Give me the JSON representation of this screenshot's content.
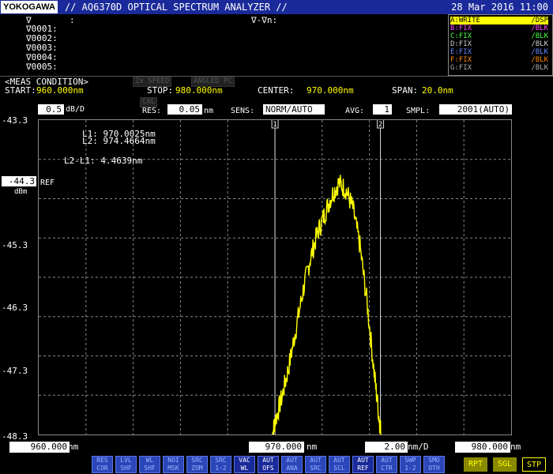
{
  "header": {
    "logo": "YOKOGAWA",
    "title": "// AQ6370D OPTICAL SPECTRUM ANALYZER //",
    "datetime": "28 Mar 2016 11:00"
  },
  "markers": {
    "main_symbol": "∇",
    "main_colon": ":",
    "delta_header": "∇-∇n:",
    "rows": [
      "∇0001:",
      "∇0002:",
      "∇0003:",
      "∇0004:",
      "∇0005:"
    ]
  },
  "traces": [
    {
      "left": "A:WRITE",
      "right": "/DSP",
      "color": "#ffff00",
      "selected": true
    },
    {
      "left": "B:FIX",
      "right": "/BLK",
      "color": "#ff44ff",
      "selected": false
    },
    {
      "left": "C:FIX",
      "right": "/BLK",
      "color": "#44ff44",
      "selected": false
    },
    {
      "left": "D:FIX",
      "right": "/BLK",
      "color": "#cccccc",
      "selected": false
    },
    {
      "left": "E:FIX",
      "right": "/BLK",
      "color": "#6688ff",
      "selected": false
    },
    {
      "left": "F:FIX",
      "right": "/BLK",
      "color": "#ff8800",
      "selected": false
    },
    {
      "left": "G:FIX",
      "right": "/BLK",
      "color": "#aaaaaa",
      "selected": false
    }
  ],
  "meas": {
    "title": "<MEAS CONDITION>",
    "speed_badge": "2x SPEED",
    "angled_badge": "ANGLED PC",
    "start_label": "START:",
    "start_value": "960.000nm",
    "stop_label": "STOP:",
    "stop_value": "980.000nm",
    "center_label": "CENTER:",
    "center_value": "970.000nm",
    "span_label": "SPAN:",
    "span_value": "20.0nm"
  },
  "settings": {
    "scale_value": "0.5",
    "scale_unit": "dB/D",
    "cal_badge": "CAL",
    "res_label": "RES:",
    "res_value": "0.05",
    "res_unit": "nm",
    "sens_label": "SENS:",
    "sens_value": "NORM/AUTO",
    "avg_label": "AVG:",
    "avg_value": "1",
    "smpl_label": "SMPL:",
    "smpl_value": "2001(AUTO)"
  },
  "plot": {
    "ref_value": "-44.3",
    "ref_label": "REF",
    "ref_unit": "dBm",
    "marker_l1": "L1:  970.0025nm",
    "marker_l2": "L2:  974.4664nm",
    "marker_delta": "L2-L1:    4.4639nm",
    "line1_tag": "1",
    "line2_tag": "2",
    "yticks": [
      "-43.3",
      "-45.3",
      "-46.3",
      "-47.3",
      "-48.3"
    ]
  },
  "footer": {
    "start": "960.000",
    "start_unit": "nm",
    "center": "970.000",
    "center_unit": "nm",
    "perdiv": "2.00",
    "perdiv_unit": "nm/D",
    "stop": "980.000",
    "stop_unit": "nm"
  },
  "softkeys": [
    {
      "top": "RES",
      "bottom": "COR",
      "on": false
    },
    {
      "top": "LVL",
      "bottom": "SHF",
      "on": false
    },
    {
      "top": "WL",
      "bottom": "SHF",
      "on": false
    },
    {
      "top": "NOI",
      "bottom": "MSK",
      "on": false
    },
    {
      "top": "SRC",
      "bottom": "ZOM",
      "on": false
    },
    {
      "top": "SRC",
      "bottom": "1-2",
      "on": false
    },
    {
      "top": "VAC",
      "bottom": "WL",
      "on": true
    },
    {
      "top": "AUT",
      "bottom": "OFS",
      "on": true
    },
    {
      "top": "AUT",
      "bottom": "ANA",
      "on": false
    },
    {
      "top": "AUT",
      "bottom": "SRC",
      "on": false
    },
    {
      "top": "AUT",
      "bottom": "SCL",
      "on": false
    },
    {
      "top": "AUT",
      "bottom": "REF",
      "on": true
    },
    {
      "top": "AUT",
      "bottom": "CTR",
      "on": false
    },
    {
      "top": "SWP",
      "bottom": "1-2",
      "on": false
    },
    {
      "top": "SMO",
      "bottom": "OTH",
      "on": false
    }
  ],
  "modes": {
    "rpt": "RPT",
    "sgl": "SGL",
    "stp": "STP"
  },
  "chart_data": {
    "type": "line",
    "xlabel": "",
    "ylabel": "",
    "xlim": [
      960.0,
      980.0
    ],
    "ylim": [
      -48.3,
      -43.3
    ],
    "series": [
      {
        "color": "#ffff00",
        "x": [
          969.9,
          970.0,
          970.3,
          970.6,
          970.9,
          971.2,
          971.5,
          971.8,
          972.1,
          972.4,
          972.7,
          973.0,
          973.3,
          973.6,
          973.9,
          974.2,
          974.4,
          974.5
        ],
        "y": [
          -48.3,
          -48.1,
          -47.7,
          -47.2,
          -46.6,
          -46.0,
          -45.5,
          -45.1,
          -44.8,
          -44.5,
          -44.3,
          -44.4,
          -44.7,
          -45.3,
          -46.2,
          -47.3,
          -48.0,
          -48.3
        ]
      }
    ],
    "vlines": [
      970.0025,
      974.4664
    ]
  }
}
